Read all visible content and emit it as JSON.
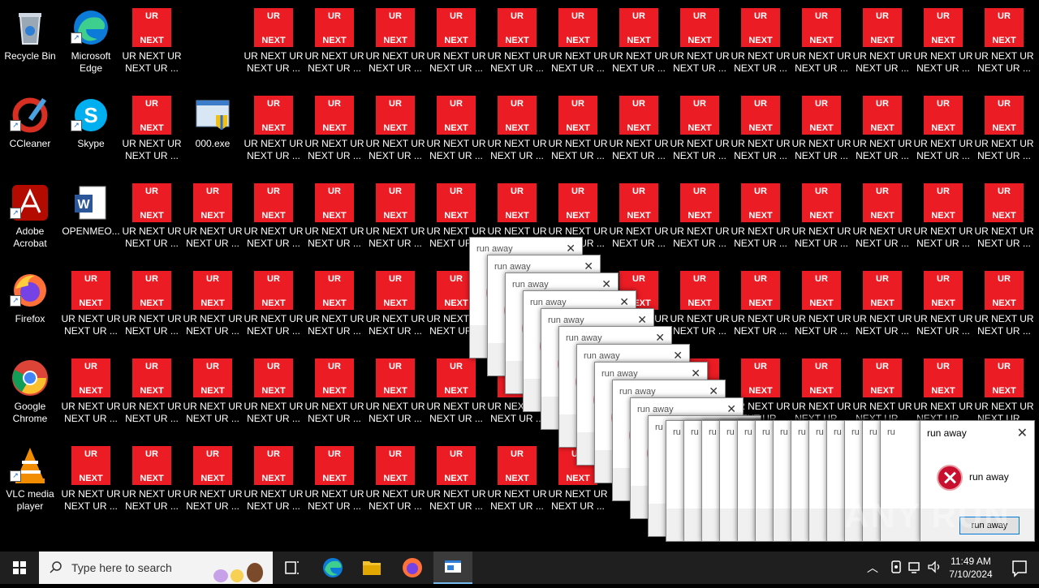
{
  "desktop": {
    "shortcuts": [
      {
        "label": "Recycle Bin",
        "icon": "recycle-bin-icon"
      },
      {
        "label": "Microsoft Edge",
        "icon": "edge-icon"
      },
      {
        "label": "CCleaner",
        "icon": "ccleaner-icon"
      },
      {
        "label": "Skype",
        "icon": "skype-icon"
      },
      {
        "label": "000.exe",
        "icon": "exe-icon"
      },
      {
        "label": "Adobe Acrobat",
        "icon": "acrobat-icon"
      },
      {
        "label": "OPENMEO...",
        "icon": "word-doc-icon"
      },
      {
        "label": "Firefox",
        "icon": "firefox-icon"
      },
      {
        "label": "Google Chrome",
        "icon": "chrome-icon"
      },
      {
        "label": "VLC media player",
        "icon": "vlc-icon"
      }
    ],
    "ur_icon": {
      "top": "UR",
      "bottom": "NEXT",
      "label": "UR NEXT UR NEXT UR ..."
    }
  },
  "dialog": {
    "title": "run away",
    "message": "run away",
    "button": "run away",
    "stack_title_fragment": "ru"
  },
  "watermark": "ANY RUN",
  "taskbar": {
    "search_placeholder": "Type here to search",
    "time": "11:49 AM",
    "date": "7/10/2024"
  }
}
